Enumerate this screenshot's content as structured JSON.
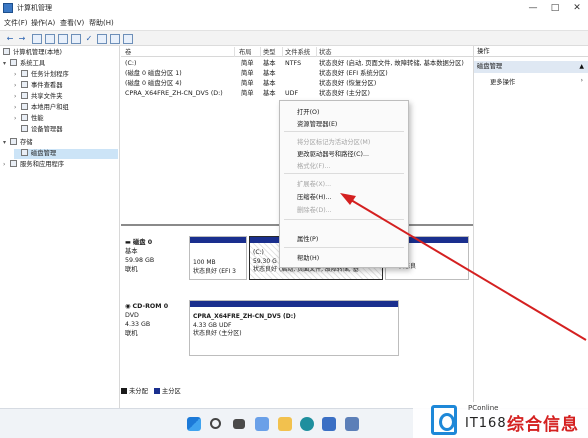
{
  "window": {
    "title": "计算机管理",
    "controls": {
      "minimize": "—",
      "maximize": "□",
      "close": "✕"
    }
  },
  "menu": [
    "文件(F)",
    "操作(A)",
    "查看(V)",
    "帮助(H)"
  ],
  "tree": [
    {
      "label": "计算机管理(本地)",
      "level": 0,
      "icon": "computer-icon"
    },
    {
      "label": "系统工具",
      "level": 1,
      "expander": "▾",
      "icon": "tools-icon"
    },
    {
      "label": "任务计划程序",
      "level": 2,
      "expander": "›",
      "icon": "clock-icon"
    },
    {
      "label": "事件查看器",
      "level": 2,
      "expander": "›",
      "icon": "event-icon"
    },
    {
      "label": "共享文件夹",
      "level": 2,
      "expander": "›",
      "icon": "folder-icon"
    },
    {
      "label": "本地用户和组",
      "level": 2,
      "expander": "›",
      "icon": "users-icon"
    },
    {
      "label": "性能",
      "level": 2,
      "expander": "›",
      "icon": "chart-icon"
    },
    {
      "label": "设备管理器",
      "level": 2,
      "icon": "device-icon"
    },
    {
      "label": "存储",
      "level": 1,
      "expander": "▾",
      "icon": "storage-icon"
    },
    {
      "label": "磁盘管理",
      "level": 2,
      "icon": "disk-icon",
      "selected": true
    },
    {
      "label": "服务和应用程序",
      "level": 1,
      "expander": "›",
      "icon": "services-icon"
    }
  ],
  "volume_table": {
    "headers": [
      "卷",
      "布局",
      "类型",
      "文件系统",
      "状态"
    ],
    "rows": [
      {
        "volume": "(C:)",
        "layout": "简单",
        "type": "基本",
        "fs": "NTFS",
        "status": "状态良好 (启动, 页面文件, 故障转储, 基本数据分区)"
      },
      {
        "volume": "(磁盘 0 磁盘分区 1)",
        "layout": "简单",
        "type": "基本",
        "fs": "",
        "status": "状态良好 (EFI 系统分区)"
      },
      {
        "volume": "(磁盘 0 磁盘分区 4)",
        "layout": "简单",
        "type": "基本",
        "fs": "",
        "status": "状态良好 (恢复分区)"
      },
      {
        "volume": "CPRA_X64FRE_ZH-CN_DV5 (D:)",
        "layout": "简单",
        "type": "基本",
        "fs": "UDF",
        "status": "状态良好 (主分区)"
      }
    ]
  },
  "actions": {
    "header": "操作",
    "section": "磁盘管理",
    "more": "更多操作"
  },
  "disks": [
    {
      "name": "磁盘 0",
      "type": "基本",
      "size": "59.98 GB",
      "state": "联机",
      "partitions": [
        {
          "lines": [
            "100 MB",
            "状态良好 (EFI 3"
          ]
        },
        {
          "lines": [
            "(C:)",
            "59.30 G",
            "状态良好 (启动, 页面文件, 故障转储, 基"
          ]
        },
        {
          "lines": [
            "",
            "",
            "状态良"
          ]
        }
      ]
    },
    {
      "name": "CD-ROM 0",
      "type": "DVD",
      "size": "4.33 GB",
      "state": "联机",
      "partitions": [
        {
          "lines": [
            "CPRA_X64FRE_ZH-CN_DV5 (D:)",
            "4.33 GB UDF",
            "状态良好 (主分区)"
          ]
        }
      ]
    }
  ],
  "legend": [
    {
      "label": "未分配",
      "color": "#1a1a1a"
    },
    {
      "label": "主分区",
      "color": "#1a2f8e"
    }
  ],
  "context_menu": [
    {
      "label": "打开(O)",
      "enabled": true
    },
    {
      "label": "资源管理器(E)",
      "enabled": true
    },
    {
      "sep": true
    },
    {
      "label": "将分区标记为活动分区(M)",
      "enabled": false
    },
    {
      "label": "更改驱动器号和路径(C)...",
      "enabled": true
    },
    {
      "label": "格式化(F)...",
      "enabled": false
    },
    {
      "sep": true
    },
    {
      "label": "扩展卷(X)...",
      "enabled": false
    },
    {
      "label": "压缩卷(H)...",
      "enabled": true
    },
    {
      "label": "删除卷(D)...",
      "enabled": false
    },
    {
      "sep": true
    },
    {
      "label": "属性(P)",
      "enabled": true
    },
    {
      "sep": true
    },
    {
      "label": "帮助(H)",
      "enabled": true
    }
  ],
  "right_overflow_text": {
    "l1": "H",
    "l2": "状态良"
  },
  "watermark": {
    "small": "PConline",
    "big": "IT168",
    "red": "综合信息"
  },
  "colors": {
    "primary_partition": "#1a2f8e",
    "selection": "#cce4f7",
    "arrow": "#d42020",
    "brand": "#1e88d8"
  }
}
